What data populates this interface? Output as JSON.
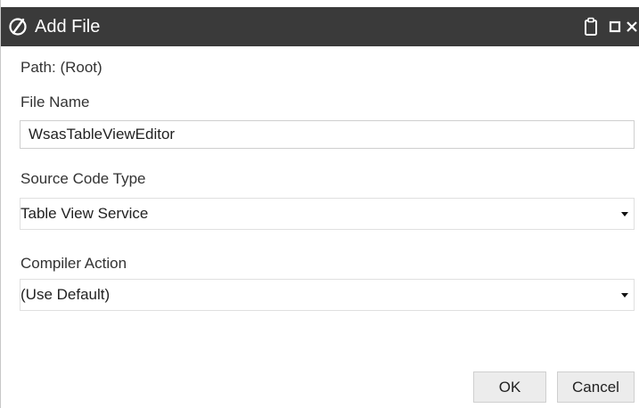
{
  "window": {
    "title": "Add File",
    "app_icon": "no-symbol-icon",
    "controls": {
      "clipboard_icon": "clipboard-icon",
      "maximize_icon": "maximize-icon",
      "close_icon": "close-icon"
    },
    "titlebar_color": "#3a3a3a"
  },
  "form": {
    "path_label": "Path:",
    "path_value": "(Root)",
    "file_name_label": "File Name",
    "file_name_value": "WsasTableViewEditor",
    "source_code_type_label": "Source Code Type",
    "source_code_type_value": "Table View Service",
    "compiler_action_label": "Compiler Action",
    "compiler_action_value": "(Use Default)"
  },
  "buttons": {
    "ok_label": "OK",
    "cancel_label": "Cancel"
  }
}
